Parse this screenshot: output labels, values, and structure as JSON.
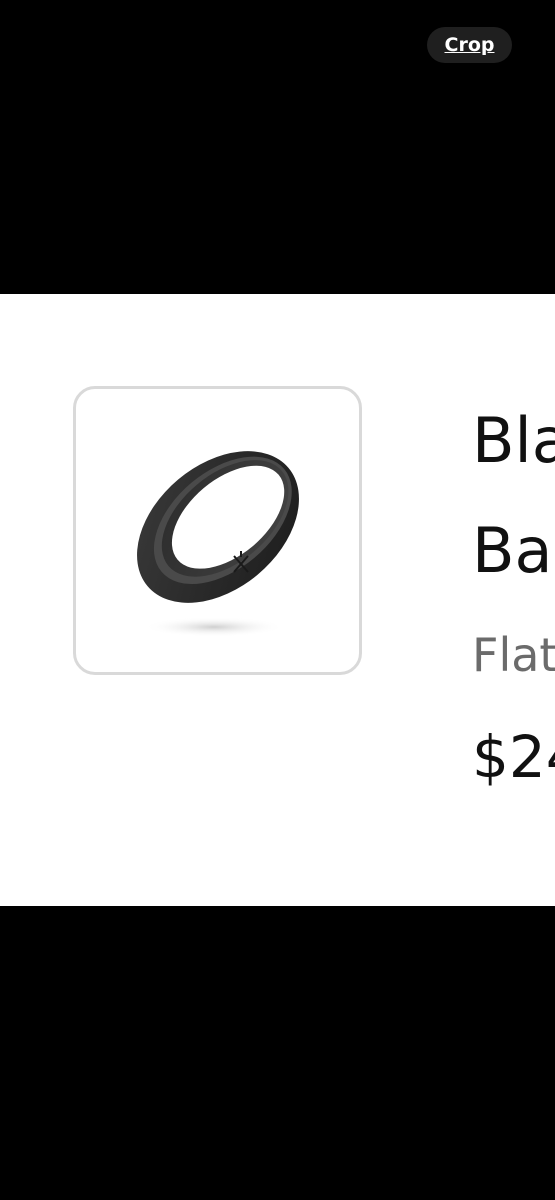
{
  "toolbar": {
    "crop_label": "Crop"
  },
  "product": {
    "title_line1": "Bla",
    "title_line2": "Ba",
    "subtitle": "Flat",
    "price": "$24",
    "image_icon": "ring-image"
  }
}
